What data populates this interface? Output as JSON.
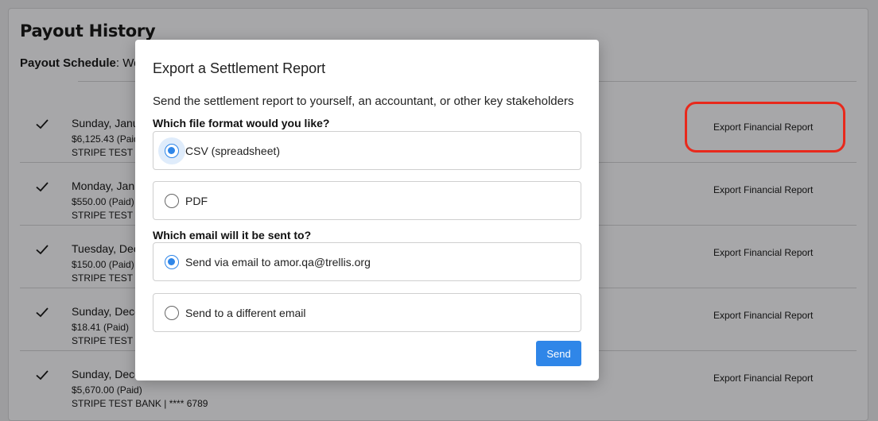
{
  "page": {
    "title": "Payout History",
    "schedule_label": "Payout Schedule",
    "schedule_value": ": We"
  },
  "payouts": [
    {
      "date": "Sunday, Janu",
      "amount": "$6,125.43 (Paid",
      "bank": "STRIPE TEST E",
      "export": "Export Financial Report"
    },
    {
      "date": "Monday, Jan",
      "amount": "$550.00 (Paid)",
      "bank": "STRIPE TEST E",
      "export": "Export Financial Report"
    },
    {
      "date": "Tuesday, Dec",
      "amount": "$150.00 (Paid)",
      "bank": "STRIPE TEST E",
      "export": "Export Financial Report"
    },
    {
      "date": "Sunday, Dece",
      "amount": "$18.41 (Paid)",
      "bank": "STRIPE TEST E",
      "export": "Export Financial Report"
    },
    {
      "date": "Sunday, Dece",
      "amount": "$5,670.00 (Paid)",
      "bank": "STRIPE TEST BANK | **** 6789",
      "export": "Export Financial Report"
    }
  ],
  "modal": {
    "title": "Export a Settlement Report",
    "description": "Send the settlement report to yourself, an accountant, or other key stakeholders",
    "format_label": "Which file format would you like?",
    "format_options": [
      {
        "label": "CSV (spreadsheet)",
        "selected": true
      },
      {
        "label": "PDF",
        "selected": false
      }
    ],
    "email_label": "Which email will it be sent to?",
    "email_options": [
      {
        "label": "Send via email to amor.qa@trellis.org",
        "selected": true
      },
      {
        "label": "Send to a different email",
        "selected": false
      }
    ],
    "send_label": "Send"
  },
  "colors": {
    "accent": "#2f86e8",
    "highlight": "#e8291c",
    "overlay": "#9d9d9f"
  }
}
